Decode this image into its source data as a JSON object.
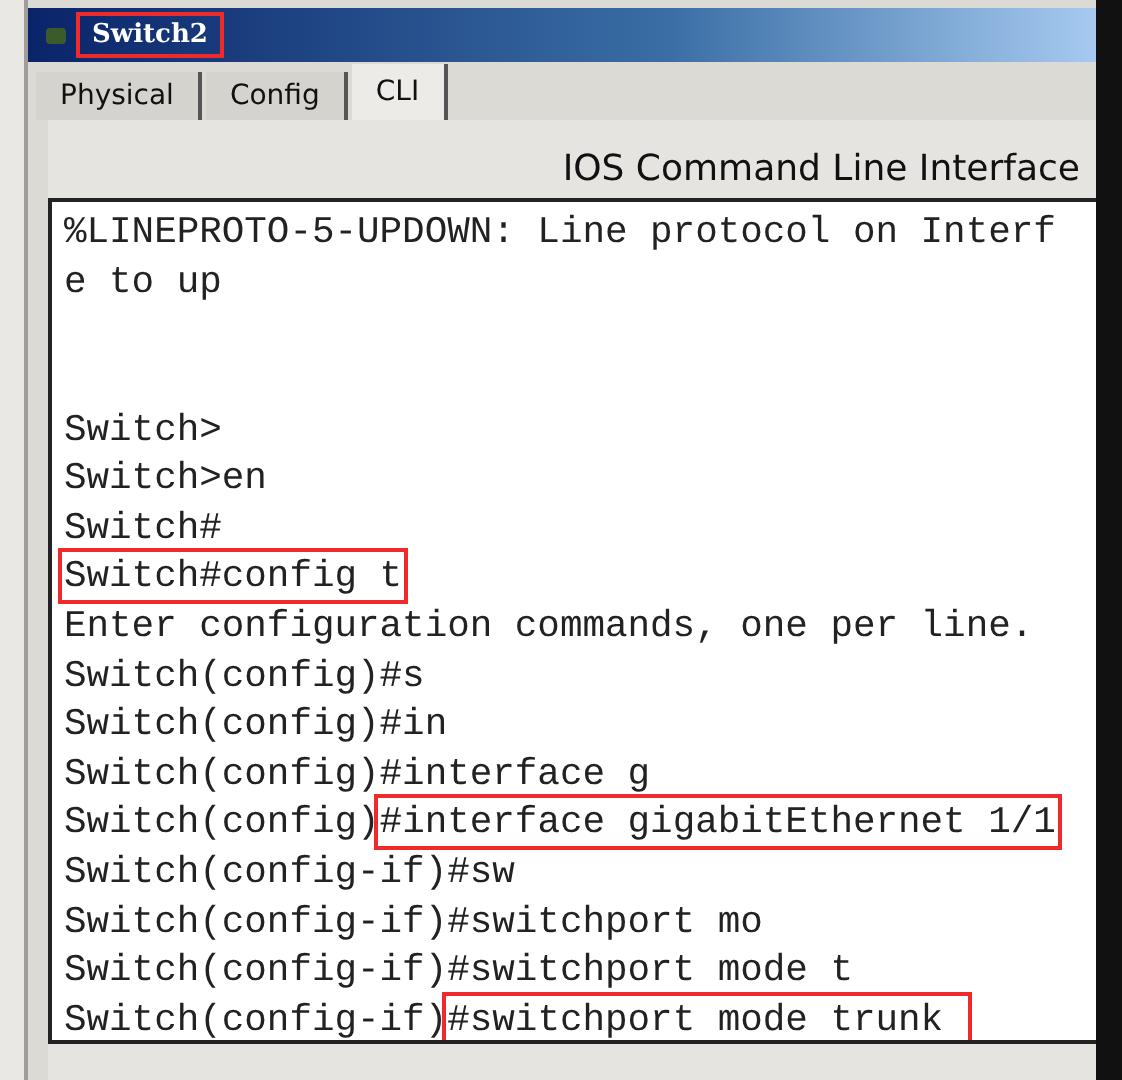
{
  "window": {
    "title": "Switch2",
    "title_boxed": true
  },
  "tabs": [
    {
      "label": "Physical",
      "selected": false
    },
    {
      "label": "Config",
      "selected": false
    },
    {
      "label": "CLI",
      "selected": true
    }
  ],
  "header": "IOS Command Line Interface",
  "terminal": {
    "lines": [
      {
        "kind": "text",
        "parts": [
          {
            "text": "%LINEPROTO-5-UPDOWN: Line protocol on Interf",
            "boxed": false
          }
        ]
      },
      {
        "kind": "text",
        "parts": [
          {
            "text": "e to up",
            "boxed": false
          }
        ]
      },
      {
        "kind": "blank"
      },
      {
        "kind": "blank"
      },
      {
        "kind": "text",
        "parts": [
          {
            "text": "Switch>",
            "boxed": false
          }
        ]
      },
      {
        "kind": "text",
        "parts": [
          {
            "text": "Switch>en",
            "boxed": false
          }
        ]
      },
      {
        "kind": "text",
        "parts": [
          {
            "text": "Switch#",
            "boxed": false
          }
        ]
      },
      {
        "kind": "text",
        "parts": [
          {
            "text": "Switch#config t",
            "boxed": true
          }
        ]
      },
      {
        "kind": "text",
        "parts": [
          {
            "text": "Enter configuration commands, one per line.",
            "boxed": false
          }
        ]
      },
      {
        "kind": "text",
        "parts": [
          {
            "text": "Switch(config)#s",
            "boxed": false
          }
        ]
      },
      {
        "kind": "text",
        "parts": [
          {
            "text": "Switch(config)#in",
            "boxed": false
          }
        ]
      },
      {
        "kind": "text",
        "parts": [
          {
            "text": "Switch(config)#interface g",
            "boxed": false
          }
        ]
      },
      {
        "kind": "text",
        "parts": [
          {
            "text": "Switch(config)",
            "boxed": false
          },
          {
            "text": "#interface gigabitEthernet 1/1",
            "boxed": true
          }
        ]
      },
      {
        "kind": "text",
        "parts": [
          {
            "text": "Switch(config-if)#sw",
            "boxed": false
          }
        ]
      },
      {
        "kind": "text",
        "parts": [
          {
            "text": "Switch(config-if)#switchport mo",
            "boxed": false
          }
        ]
      },
      {
        "kind": "text",
        "parts": [
          {
            "text": "Switch(config-if)#switchport mode t",
            "boxed": false
          }
        ]
      },
      {
        "kind": "text",
        "parts": [
          {
            "text": "Switch(config-if)",
            "boxed": false
          },
          {
            "text": "#switchport mode trunk ",
            "boxed": true
          }
        ]
      }
    ]
  }
}
